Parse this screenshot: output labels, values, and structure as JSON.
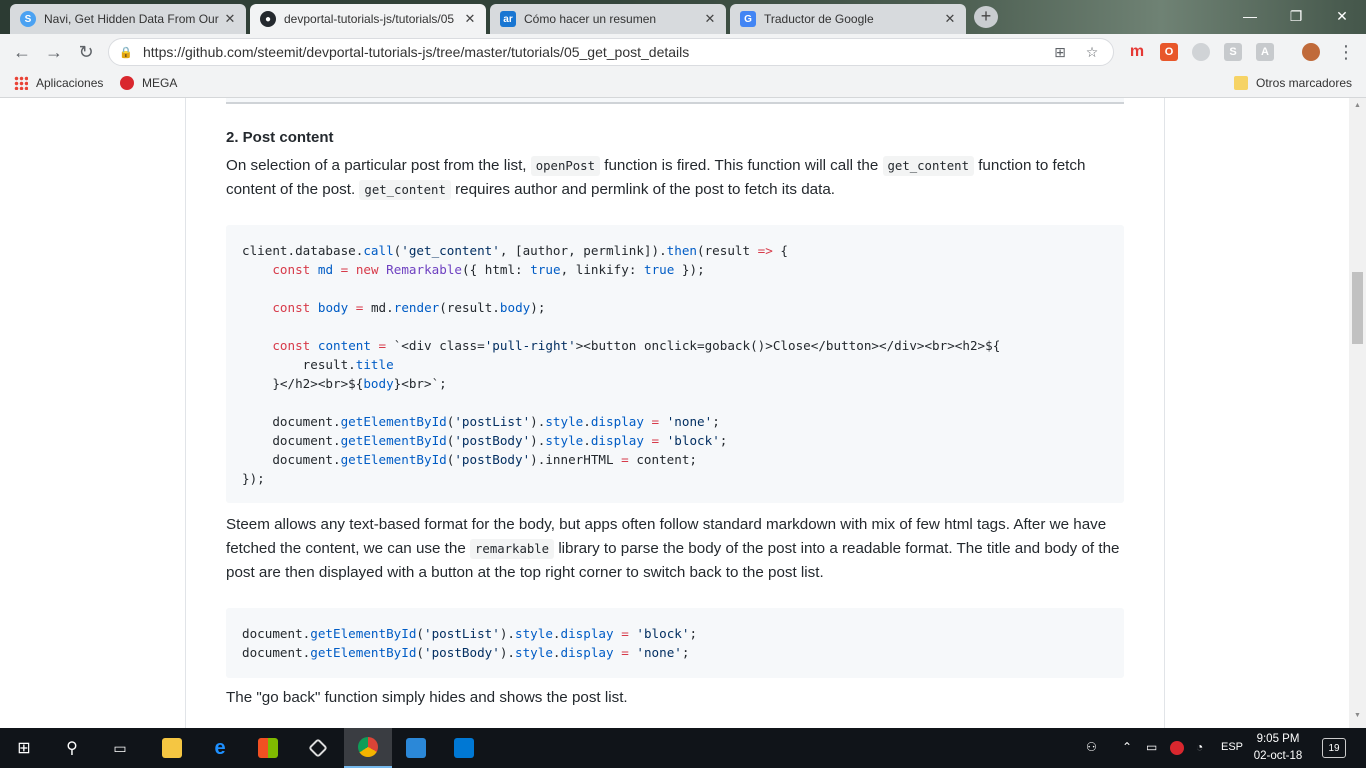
{
  "tabs": [
    {
      "title": "Navi, Get Hidden Data From Our",
      "icon": "steemit-icon",
      "color": "#4ba2f2"
    },
    {
      "title": "devportal-tutorials-js/tutorials/05",
      "icon": "github-icon",
      "color": "#24292e"
    },
    {
      "title": "Cómo hacer un resumen",
      "icon": "ar-icon",
      "color": "#1976d2"
    },
    {
      "title": "Traductor de Google",
      "icon": "google-translate-icon",
      "color": "#4285f4"
    }
  ],
  "address": {
    "url": "https://github.com/steemit/devportal-tutorials-js/tree/master/tutorials/05_get_post_details"
  },
  "bookmarks": {
    "apps": "Aplicaciones",
    "mega": "MEGA",
    "other": "Otros marcadores"
  },
  "content": {
    "heading": "2. Post content",
    "p1": {
      "t1": "On selection of a particular post from the list,",
      "c1": "openPost",
      "t2": "function is fired. This function will call the",
      "c2": "get_content",
      "t3": "function to fetch content of the post.",
      "c3": "get_content",
      "t4": "requires author and permlink of the post to fetch its data."
    },
    "code1": [
      "client.database.call('get_content', [author, permlink]).then(result => {",
      "    const md = new Remarkable({ html: true, linkify: true });",
      "",
      "    const body = md.render(result.body);",
      "",
      "    const content = `<div class='pull-right'><button onclick=goback()>Close</button></div><br><h2>${",
      "        result.title",
      "    }</h2><br>${body}<br>`;",
      "",
      "    document.getElementById('postList').style.display = 'none';",
      "    document.getElementById('postBody').style.display = 'block';",
      "    document.getElementById('postBody').innerHTML = content;",
      "});"
    ],
    "p2": {
      "t1": "Steem allows any text-based format for the body, but apps often follow standard markdown with mix of few html tags. After we have fetched the content, we can use the",
      "c1": "remarkable",
      "t2": "library to parse the body of the post into a readable format. The title and body of the post are then displayed with a button at the top right corner to switch back to the post list."
    },
    "code2": [
      "document.getElementById('postList').style.display = 'block';",
      "document.getElementById('postBody').style.display = 'none';"
    ],
    "p3": "The \"go back\" function simply hides and shows the post list."
  },
  "taskbar": {
    "lang": "ESP",
    "time": "9:05 PM",
    "date": "02-oct-18",
    "notifications": "19"
  }
}
